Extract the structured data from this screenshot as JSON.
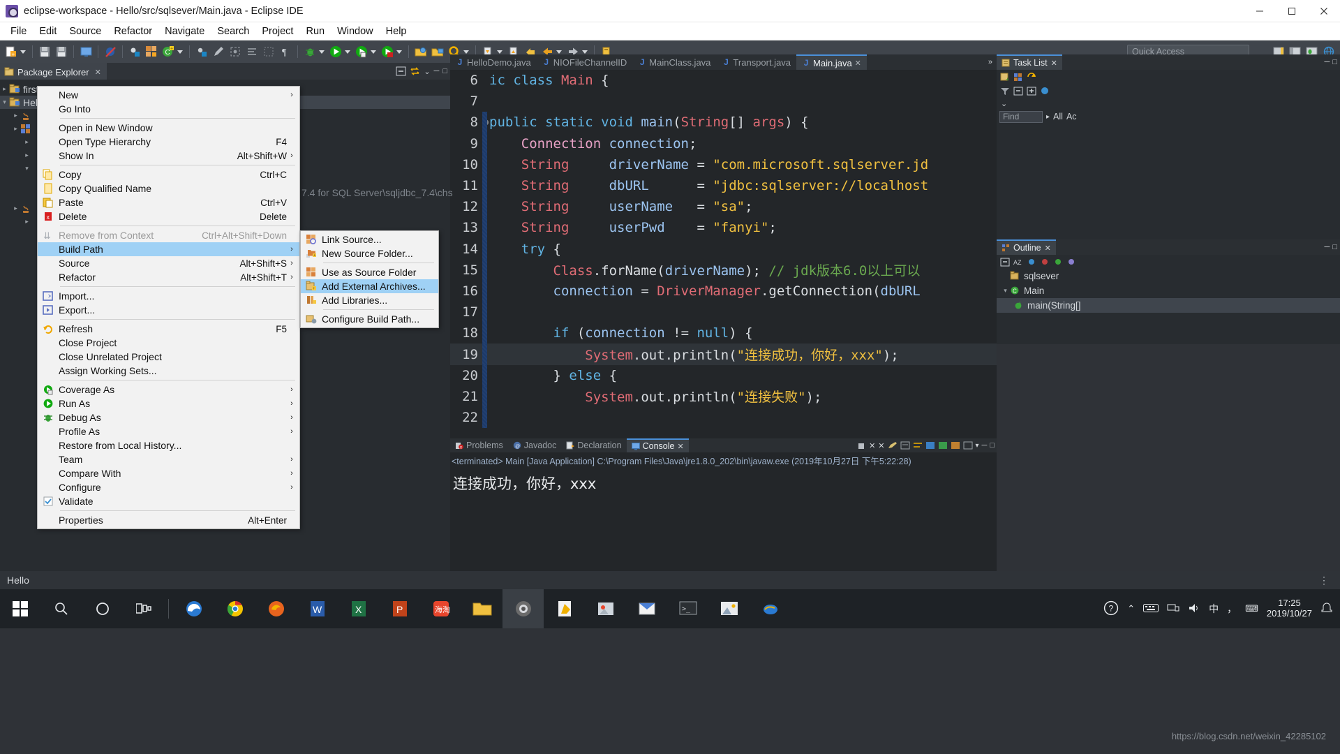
{
  "window": {
    "title": "eclipse-workspace - Hello/src/sqlsever/Main.java - Eclipse IDE",
    "app_icon": "eclipse-icon",
    "minimize": "–",
    "maximize": "□",
    "close": "✕"
  },
  "menubar": [
    "File",
    "Edit",
    "Source",
    "Refactor",
    "Navigate",
    "Search",
    "Project",
    "Run",
    "Window",
    "Help"
  ],
  "toolbar": {
    "quick_access_placeholder": "Quick Access"
  },
  "package_explorer": {
    "tab_label": "Package Explorer",
    "close_glyph": "✕",
    "tree": [
      {
        "label": "first",
        "icon": "java-project-icon",
        "arrow": "▸",
        "indent": 0
      },
      {
        "label": "Hello",
        "icon": "java-project-icon",
        "arrow": "▾",
        "indent": 0,
        "selected": true
      }
    ],
    "status_text": "Hello"
  },
  "context_menu": {
    "items": [
      {
        "label": "New",
        "accel": "",
        "icon": "",
        "arrow": "›"
      },
      {
        "label": "Go Into",
        "accel": "",
        "icon": ""
      },
      {
        "sep": true
      },
      {
        "label": "Open in New Window",
        "accel": "",
        "icon": ""
      },
      {
        "label": "Open Type Hierarchy",
        "accel": "F4",
        "icon": ""
      },
      {
        "label": "Show In",
        "accel": "Alt+Shift+W",
        "icon": "",
        "arrow": "›"
      },
      {
        "sep": true
      },
      {
        "label": "Copy",
        "accel": "Ctrl+C",
        "icon": "copy-icon"
      },
      {
        "label": "Copy Qualified Name",
        "accel": "",
        "icon": "copy-qualified-icon"
      },
      {
        "label": "Paste",
        "accel": "Ctrl+V",
        "icon": "paste-icon"
      },
      {
        "label": "Delete",
        "accel": "Delete",
        "icon": "delete-icon"
      },
      {
        "sep": true
      },
      {
        "label": "Remove from Context",
        "accel": "Ctrl+Alt+Shift+Down",
        "icon": "remove-context-icon",
        "disabled": true
      },
      {
        "label": "Build Path",
        "accel": "",
        "icon": "",
        "arrow": "›",
        "selected": true
      },
      {
        "label": "Source",
        "accel": "Alt+Shift+S",
        "icon": "",
        "arrow": "›"
      },
      {
        "label": "Refactor",
        "accel": "Alt+Shift+T",
        "icon": "",
        "arrow": "›"
      },
      {
        "sep": true
      },
      {
        "label": "Import...",
        "accel": "",
        "icon": "import-icon"
      },
      {
        "label": "Export...",
        "accel": "",
        "icon": "export-icon"
      },
      {
        "sep": true
      },
      {
        "label": "Refresh",
        "accel": "F5",
        "icon": "refresh-icon"
      },
      {
        "label": "Close Project",
        "accel": "",
        "icon": ""
      },
      {
        "label": "Close Unrelated Project",
        "accel": "",
        "icon": ""
      },
      {
        "label": "Assign Working Sets...",
        "accel": "",
        "icon": ""
      },
      {
        "sep": true
      },
      {
        "label": "Coverage As",
        "accel": "",
        "icon": "coverage-icon",
        "arrow": "›"
      },
      {
        "label": "Run As",
        "accel": "",
        "icon": "run-icon",
        "arrow": "›"
      },
      {
        "label": "Debug As",
        "accel": "",
        "icon": "debug-icon",
        "arrow": "›"
      },
      {
        "label": "Profile As",
        "accel": "",
        "icon": "",
        "arrow": "›"
      },
      {
        "label": "Restore from Local History...",
        "accel": "",
        "icon": ""
      },
      {
        "label": "Team",
        "accel": "",
        "icon": "",
        "arrow": "›"
      },
      {
        "label": "Compare With",
        "accel": "",
        "icon": "",
        "arrow": "›"
      },
      {
        "label": "Configure",
        "accel": "",
        "icon": "",
        "arrow": "›"
      },
      {
        "label": "Validate",
        "accel": "",
        "icon": "validate-icon"
      },
      {
        "sep": true
      },
      {
        "label": "Properties",
        "accel": "Alt+Enter",
        "icon": ""
      }
    ]
  },
  "build_path_submenu": {
    "items": [
      {
        "label": "Link Source...",
        "icon": "link-source-icon"
      },
      {
        "label": "New Source Folder...",
        "icon": "new-source-folder-icon"
      },
      {
        "sep": true
      },
      {
        "label": "Use as Source Folder",
        "icon": "use-source-folder-icon"
      },
      {
        "label": "Add External Archives...",
        "icon": "add-external-archives-icon",
        "selected": true
      },
      {
        "label": "Add Libraries...",
        "icon": "add-libraries-icon"
      },
      {
        "sep": true
      },
      {
        "label": "Configure Build Path...",
        "icon": "configure-build-path-icon"
      }
    ]
  },
  "editor": {
    "tabs": [
      {
        "label": "HelloDemo.java",
        "active": false,
        "closable": false
      },
      {
        "label": "NIOFileChannelID",
        "active": false,
        "closable": false
      },
      {
        "label": "MainClass.java",
        "active": false,
        "closable": false
      },
      {
        "label": "Transport.java",
        "active": false,
        "closable": false
      },
      {
        "label": "Main.java",
        "active": true,
        "closable": true
      }
    ],
    "overflow_glyph": "»",
    "code_lines": [
      {
        "n": "6",
        "fold": "",
        "segments": [
          {
            "t": "ic ",
            "c": "kw"
          },
          {
            "t": "class ",
            "c": "kw"
          },
          {
            "t": "Main",
            "c": "typ"
          },
          {
            "t": " {",
            "c": "plain"
          }
        ]
      },
      {
        "n": "7",
        "fold": "",
        "segments": []
      },
      {
        "n": "8",
        "fold": "●",
        "change": true,
        "segments": [
          {
            "t": "public static void ",
            "c": "kw"
          },
          {
            "t": "main",
            "c": "var"
          },
          {
            "t": "(",
            "c": "plain"
          },
          {
            "t": "String",
            "c": "typ"
          },
          {
            "t": "[] ",
            "c": "plain"
          },
          {
            "t": "args",
            "c": "typ"
          },
          {
            "t": ") {",
            "c": "plain"
          }
        ]
      },
      {
        "n": "9",
        "fold": "",
        "change": true,
        "segments": [
          {
            "t": "    ",
            "c": "plain"
          },
          {
            "t": "Connection",
            "c": "pink"
          },
          {
            "t": " ",
            "c": "plain"
          },
          {
            "t": "connection",
            "c": "var"
          },
          {
            "t": ";",
            "c": "plain"
          }
        ]
      },
      {
        "n": "10",
        "fold": "",
        "change": true,
        "segments": [
          {
            "t": "    ",
            "c": "plain"
          },
          {
            "t": "String",
            "c": "typ"
          },
          {
            "t": "     ",
            "c": "plain"
          },
          {
            "t": "driverName",
            "c": "var"
          },
          {
            "t": " = ",
            "c": "plain"
          },
          {
            "t": "\"com.microsoft.sqlserver.jd",
            "c": "str"
          }
        ]
      },
      {
        "n": "11",
        "fold": "",
        "change": true,
        "segments": [
          {
            "t": "    ",
            "c": "plain"
          },
          {
            "t": "String",
            "c": "typ"
          },
          {
            "t": "     ",
            "c": "plain"
          },
          {
            "t": "dbURL",
            "c": "var"
          },
          {
            "t": "      = ",
            "c": "plain"
          },
          {
            "t": "\"jdbc:sqlserver://localhost",
            "c": "str"
          }
        ]
      },
      {
        "n": "12",
        "fold": "",
        "change": true,
        "segments": [
          {
            "t": "    ",
            "c": "plain"
          },
          {
            "t": "String",
            "c": "typ"
          },
          {
            "t": "     ",
            "c": "plain"
          },
          {
            "t": "userName",
            "c": "var"
          },
          {
            "t": "   = ",
            "c": "plain"
          },
          {
            "t": "\"sa\"",
            "c": "str"
          },
          {
            "t": ";",
            "c": "plain"
          }
        ]
      },
      {
        "n": "13",
        "fold": "",
        "change": true,
        "segments": [
          {
            "t": "    ",
            "c": "plain"
          },
          {
            "t": "String",
            "c": "typ"
          },
          {
            "t": "     ",
            "c": "plain"
          },
          {
            "t": "userPwd",
            "c": "var"
          },
          {
            "t": "    = ",
            "c": "plain"
          },
          {
            "t": "\"fanyi\"",
            "c": "str"
          },
          {
            "t": ";",
            "c": "plain"
          }
        ]
      },
      {
        "n": "14",
        "fold": "",
        "change": true,
        "segments": [
          {
            "t": "    ",
            "c": "plain"
          },
          {
            "t": "try",
            "c": "kw"
          },
          {
            "t": " {",
            "c": "plain"
          }
        ]
      },
      {
        "n": "15",
        "fold": "",
        "change": true,
        "segments": [
          {
            "t": "        ",
            "c": "plain"
          },
          {
            "t": "Class",
            "c": "typ"
          },
          {
            "t": ".",
            "c": "plain"
          },
          {
            "t": "forName",
            "c": "plain"
          },
          {
            "t": "(",
            "c": "plain"
          },
          {
            "t": "driverName",
            "c": "var"
          },
          {
            "t": "); ",
            "c": "plain"
          },
          {
            "t": "// jdk版本6.0以上可以",
            "c": "cmt"
          }
        ]
      },
      {
        "n": "16",
        "fold": "",
        "change": true,
        "segments": [
          {
            "t": "        ",
            "c": "plain"
          },
          {
            "t": "connection",
            "c": "var"
          },
          {
            "t": " = ",
            "c": "plain"
          },
          {
            "t": "DriverManager",
            "c": "typ"
          },
          {
            "t": ".getConnection(",
            "c": "plain"
          },
          {
            "t": "dbURL",
            "c": "var"
          }
        ]
      },
      {
        "n": "17",
        "fold": "",
        "change": true,
        "segments": []
      },
      {
        "n": "18",
        "fold": "",
        "change": true,
        "segments": [
          {
            "t": "        ",
            "c": "plain"
          },
          {
            "t": "if",
            "c": "kw"
          },
          {
            "t": " (",
            "c": "plain"
          },
          {
            "t": "connection",
            "c": "var"
          },
          {
            "t": " != ",
            "c": "plain"
          },
          {
            "t": "null",
            "c": "kw"
          },
          {
            "t": ") {",
            "c": "plain"
          }
        ]
      },
      {
        "n": "19",
        "fold": "",
        "change": true,
        "highlight": true,
        "segments": [
          {
            "t": "            ",
            "c": "plain"
          },
          {
            "t": "System",
            "c": "typ"
          },
          {
            "t": ".out.println(",
            "c": "plain"
          },
          {
            "t": "\"连接成功，你好，xxx\"",
            "c": "str"
          },
          {
            "t": ");",
            "c": "plain"
          }
        ]
      },
      {
        "n": "20",
        "fold": "",
        "change": true,
        "segments": [
          {
            "t": "        } ",
            "c": "plain"
          },
          {
            "t": "else",
            "c": "kw"
          },
          {
            "t": " {",
            "c": "plain"
          }
        ]
      },
      {
        "n": "21",
        "fold": "",
        "change": true,
        "segments": [
          {
            "t": "            ",
            "c": "plain"
          },
          {
            "t": "System",
            "c": "typ"
          },
          {
            "t": ".out.println(",
            "c": "plain"
          },
          {
            "t": "\"连接失败\"",
            "c": "str"
          },
          {
            "t": ");",
            "c": "plain"
          }
        ]
      },
      {
        "n": "22",
        "fold": "",
        "change": true,
        "segments": []
      }
    ],
    "hidden_path_hint": "7.4 for SQL Server\\sqljdbc_7.4\\chs"
  },
  "console": {
    "tabs": [
      {
        "label": "Problems",
        "icon": "problems-icon",
        "active": false
      },
      {
        "label": "Javadoc",
        "icon": "javadoc-icon",
        "active": false
      },
      {
        "label": "Declaration",
        "icon": "declaration-icon",
        "active": false
      },
      {
        "label": "Console",
        "icon": "console-icon",
        "active": true,
        "close_glyph": "✕"
      }
    ],
    "header": "<terminated> Main [Java Application] C:\\Program Files\\Java\\jre1.8.0_202\\bin\\javaw.exe (2019年10月27日 下午5:22:28)",
    "output": "连接成功，你好，xxx"
  },
  "task_list": {
    "tab_label": "Task List",
    "close_glyph": "✕",
    "find_placeholder": "Find",
    "all_label": "All",
    "activate_label": "Ac",
    "chevron": "⌄"
  },
  "outline": {
    "tab_label": "Outline",
    "close_glyph": "✕",
    "items": [
      {
        "label": "sqlsever",
        "icon": "package-icon",
        "indent": 0,
        "arrow": ""
      },
      {
        "label": "Main",
        "icon": "class-icon",
        "indent": 0,
        "arrow": "▾"
      },
      {
        "label": "main(String[]",
        "icon": "method-icon",
        "indent": 1,
        "arrow": "",
        "selected": true
      }
    ]
  },
  "statusbar": {
    "text": "Hello",
    "dots": "⋮"
  },
  "taskbar": {
    "start_icon": "windows-start-icon",
    "items": [
      {
        "name": "search-icon"
      },
      {
        "name": "cortana-icon"
      },
      {
        "name": "task-view-icon"
      },
      {
        "name": "edge-icon"
      },
      {
        "name": "chrome-icon"
      },
      {
        "name": "firefox-icon"
      },
      {
        "name": "word-icon"
      },
      {
        "name": "excel-icon"
      },
      {
        "name": "powerpoint-icon"
      },
      {
        "name": "haitao-icon"
      },
      {
        "name": "explorer-icon"
      },
      {
        "name": "eclipse-icon",
        "active": true
      },
      {
        "name": "notepad-icon"
      },
      {
        "name": "photos-icon"
      },
      {
        "name": "outlook-icon"
      },
      {
        "name": "terminal-icon"
      },
      {
        "name": "gallery-icon"
      },
      {
        "name": "mysql-icon"
      }
    ],
    "tray": {
      "help_icon": "help-icon",
      "chevron": "⌃",
      "icons": [
        "keyboard-icon",
        "network-icon",
        "volume-icon",
        "ime-cn",
        "ime-zhong",
        "ime-dot"
      ],
      "time": "17:25",
      "date": "2019/10/27"
    }
  },
  "watermark": "https://blog.csdn.net/weixin_42285102"
}
